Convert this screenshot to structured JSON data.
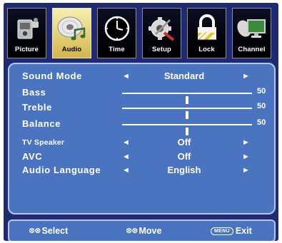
{
  "tabs": [
    {
      "label": "Picture",
      "icon": "camera-icon",
      "active": false
    },
    {
      "label": "Audio",
      "icon": "music-disc-icon",
      "active": true
    },
    {
      "label": "Time",
      "icon": "clock-icon",
      "active": false
    },
    {
      "label": "Setup",
      "icon": "gear-tools-icon",
      "active": false
    },
    {
      "label": "Lock",
      "icon": "padlock-icon",
      "active": false
    },
    {
      "label": "Channel",
      "icon": "satellite-monitor-icon",
      "active": false
    }
  ],
  "audio": {
    "sound_mode": {
      "label": "Sound Mode",
      "value": "Standard"
    },
    "bass": {
      "label": "Bass",
      "value": "50",
      "level": 0.5
    },
    "treble": {
      "label": "Treble",
      "value": "50",
      "level": 0.5
    },
    "balance": {
      "label": "Balance",
      "value": "50",
      "level": 0.5
    },
    "tv_speaker": {
      "label": "TV Speaker",
      "value": "Off"
    },
    "avc": {
      "label": "AVC",
      "value": "Off"
    },
    "audio_language": {
      "label": "Audio Language",
      "value": "English"
    }
  },
  "arrows": {
    "left": "◄",
    "right": "►"
  },
  "footer": {
    "select": {
      "glyph": "⊗⊗",
      "label": "Select"
    },
    "move": {
      "glyph": "⊗⊗",
      "label": "Move"
    },
    "exit": {
      "key": "MENU",
      "label": "Exit"
    }
  },
  "colors": {
    "frame": "#1f2a72",
    "panel": "#4b74c0",
    "panel_border": "#b6c8ea",
    "active_tab": "#e6d47e"
  }
}
